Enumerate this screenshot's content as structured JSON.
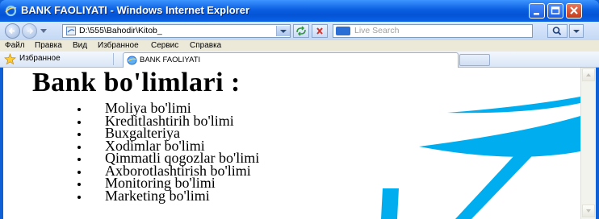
{
  "window": {
    "title": "BANK FAOLIYATI - Windows Internet Explorer"
  },
  "address_bar": {
    "url": "D:\\555\\Bahodir\\Kitob_",
    "search_placeholder": "Live Search"
  },
  "menu": {
    "items": [
      "Файл",
      "Правка",
      "Вид",
      "Избранное",
      "Сервис",
      "Справка"
    ]
  },
  "favorites_bar": {
    "label": "Избранное",
    "tab_label": "BANK FAOLIYATI"
  },
  "page": {
    "heading": "Bank bo'limlari :",
    "departments": [
      "Moliya bo'limi",
      "Kreditlashtirih bo'limi",
      "Buxgalteriya",
      "Xodimlar bo'limi",
      "Qimmatli qogozlar bo'limi",
      "Axborotlashtirish bo'limi",
      "Monitoring bo'limi",
      "Marketing bo'limi"
    ]
  },
  "colors": {
    "titlebar": "#0a5ee0",
    "menubar": "#ece9d8",
    "page_background": "#ffffff",
    "decoration_cyan": "#00aeef",
    "text": "#000000"
  }
}
